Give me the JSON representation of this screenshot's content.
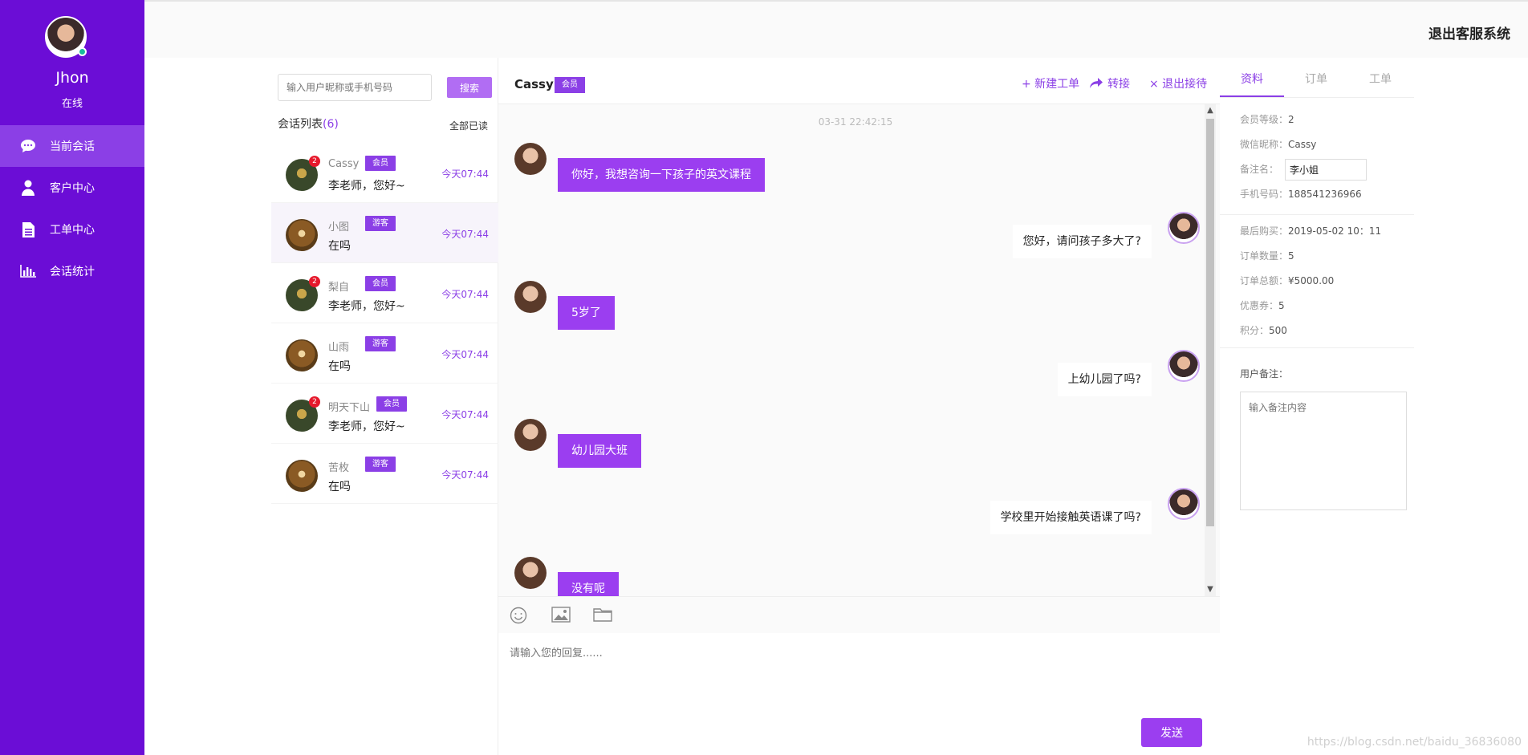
{
  "header": {
    "logout_system": "退出客服系统"
  },
  "agent": {
    "name": "Jhon",
    "status": "在线"
  },
  "nav": [
    {
      "label": "当前会话",
      "icon": "chat-bubble-icon",
      "active": true
    },
    {
      "label": "客户中心",
      "icon": "user-icon",
      "active": false
    },
    {
      "label": "工单中心",
      "icon": "document-icon",
      "active": false
    },
    {
      "label": "会话统计",
      "icon": "bar-chart-icon",
      "active": false
    }
  ],
  "conversations": {
    "search_placeholder": "输入用户昵称或手机号码",
    "search_button": "搜索",
    "list_title": "会话列表",
    "list_count": "(6)",
    "mark_all_read": "全部已读",
    "items": [
      {
        "name": "Cassy",
        "tag": "会员",
        "message": "李老师，您好~",
        "time": "今天07:44",
        "badge": "2"
      },
      {
        "name": "小图",
        "tag": "游客",
        "message": "在吗",
        "time": "今天07:44",
        "badge": ""
      },
      {
        "name": "梨自",
        "tag": "会员",
        "message": "李老师，您好~",
        "time": "今天07:44",
        "badge": "2"
      },
      {
        "name": "山雨",
        "tag": "游客",
        "message": "在吗",
        "time": "今天07:44",
        "badge": ""
      },
      {
        "name": "明天下山",
        "tag": "会员",
        "message": "李老师，您好~",
        "time": "今天07:44",
        "badge": "2"
      },
      {
        "name": "苦枚",
        "tag": "游客",
        "message": "在吗",
        "time": "今天07:44",
        "badge": ""
      }
    ]
  },
  "chat": {
    "name": "Cassy",
    "tag": "会员",
    "actions": {
      "new_ticket": "+ 新建工单",
      "transfer": "转接",
      "exit": "× 退出接待"
    },
    "timestamp": "03-31 22:42:15",
    "messages": [
      {
        "from": "customer",
        "text": "你好，我想咨询一下孩子的英文课程"
      },
      {
        "from": "agent",
        "text": "您好，请问孩子多大了?"
      },
      {
        "from": "customer",
        "text": "5岁了"
      },
      {
        "from": "agent",
        "text": "上幼儿园了吗?"
      },
      {
        "from": "customer",
        "text": "幼儿园大班"
      },
      {
        "from": "agent",
        "text": "学校里开始接触英语课了吗?"
      },
      {
        "from": "customer",
        "text": "没有呢"
      }
    ],
    "reply_placeholder": "请输入您的回复......",
    "send_button": "发送"
  },
  "info": {
    "tabs": [
      "资料",
      "订单",
      "工单"
    ],
    "member_level_label": "会员等级：",
    "member_level": "2",
    "nickname_label": "微信昵称：",
    "nickname": "Cassy",
    "remark_label": "备注名：",
    "remark_value": "李小姐",
    "phone_label": "手机号码：",
    "phone": "188541236966",
    "last_purchase_label": "最后购买：",
    "last_purchase": "2019-05-02  10：11",
    "order_count_label": "订单数量：",
    "order_count": "5",
    "order_total_label": "订单总额：",
    "order_total": "¥5000.00",
    "coupons_label": "优惠券：",
    "coupons": "5",
    "points_label": "积分：",
    "points": "500",
    "user_notes_label": "用户备注：",
    "notes_placeholder": "输入备注内容"
  },
  "watermark": "https://blog.csdn.net/baidu_36836080",
  "colors": {
    "sidebar": "#6b0dd6",
    "accent": "#8b3fe6",
    "bubble": "#9b3ef0"
  }
}
